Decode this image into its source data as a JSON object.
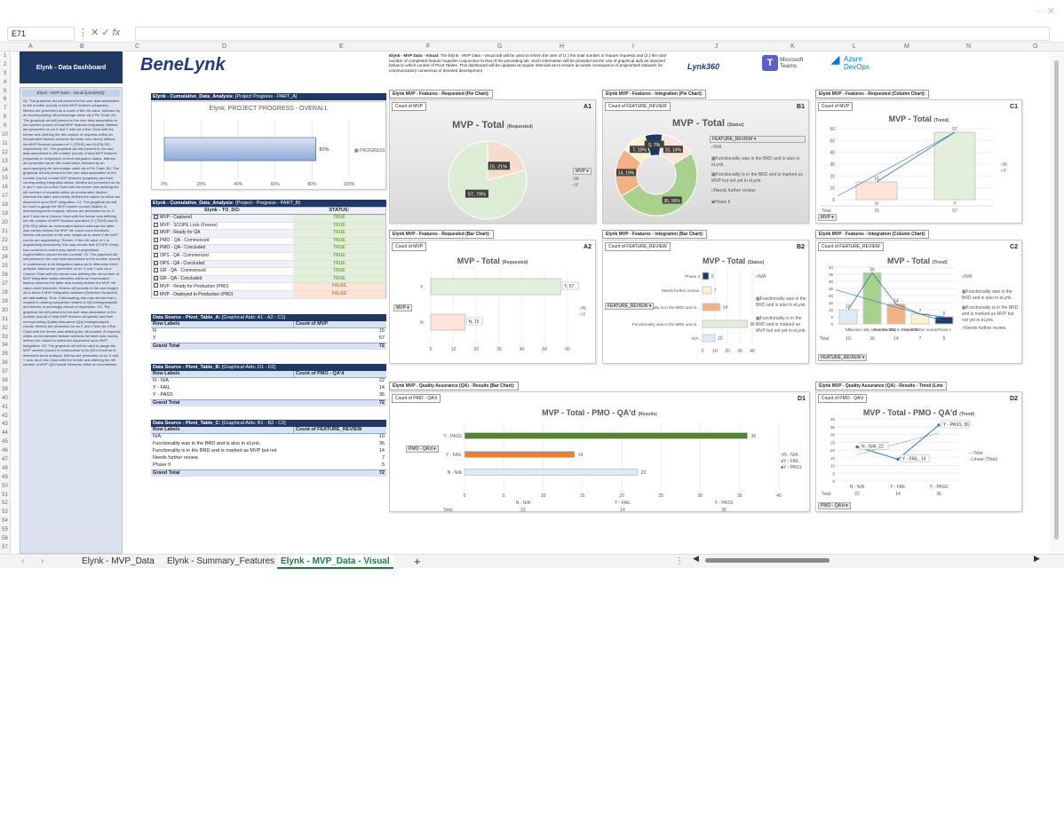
{
  "window": {
    "title_controls": "··· ✕"
  },
  "formula_bar": {
    "cell_ref": "E71",
    "fx": "fx",
    "value": ""
  },
  "columns": [
    "A",
    "B",
    "C",
    "D",
    "E",
    "F",
    "G",
    "H",
    "I",
    "J",
    "K",
    "L",
    "M",
    "N",
    "O"
  ],
  "header": {
    "dashboard_title": "Elynk - Data Dashboard",
    "logo": "BeneLynk",
    "intro_bold": "Elynk - MVP Data - Visual:",
    "intro_text": "The Elynk - MVP Data - Visual tab will be used to inform the user of (1.) the total number or feature requests and (2.) the total number of completed feature requests conjunctive to that of the preceding tab. Such information will be provided via the use of graphical aids as depicted below to which consist of Pivot Tables. This dashboard will be updated at regular intervals as to ensure accurate conveyance of project/task statuses for communicatory consensus of denoted development",
    "lynk360": "Lynk360",
    "teams": "Microsoft Teams",
    "azure": "Azure DevOps"
  },
  "legend_panel": {
    "title": "Elynk - MVP Data - Visual [LEGEND]:",
    "text": "A1: The graphical aid will present to the user data associative to the number (count) of total MVP features (requests). Metrics are presented as a count of the nth value, followed by an accompanying nth percentage value via a Pie Chart. A2: The graphical aid will present to the user data associative to the number (count) of total MVP features (requests). Metrics are presented on an X and Y axis via a Bar Chart with the former axis defining the nth number of requests within an enumerated fashion whereas the latter axis merely defines the MVP Boolean operator of Y (TRUE) and N (FALSE) respectively. B1: The graphical aid will present to the user data associated to the number (count) of total MVP features (requests) in conjunction to their integration status. Metrics are presented as an nth count value, followed by an accompanying nth percentage value via a Pie Chart. B2: The graphical aid will present to the user data associative to the number (count) of total MVP features (requests) and their corresponding integration status. Metrics are presented on an X and Y axis via a Bar Chart with the former axis defining the nth number of requests within an enumerated fashion whereas the latter axis merely defines the values to which are dependent upon MVP integration. C1: The graphical aid will be used to gauge the MVP number (count) relative to determining trend analysis. Metrics are presented on an X and Y axis via a Column Chart with the former axis defining the nth number of MVP Boolean operators (Y (TRUE) and N (FALSE)) within an enumerated fashion whereas the latter axis merely defines the MVP nth value count threshold. Metrics will provide to the user insight as to deem if the MVP counts are augmenting. Therein, if the nth value of Y is augmenting excessively, this may denote that SCOPE Creep has occurred to which may stymie a project/task. Augmentation should remain nominal. C2: The graphical aid will present to the user data associative to the number (count) in coalescence to its integration status as to determine trend analysis. Metrics are presented on an X and Y axis via a Column Chart with the former axis defining the nth number of MVP integration status elements within an enumerated fashion whereas the latter axis merely defines the MVP nth value count threshold. Metrics will provide to the user insight as to deem if MVP integration statuses (Selection Required) are attenuating. Thus, if attenuating, this may denote that a request is nearing completion relative to QA testing/analysis and therein, is seemingly devoid of regression. D1: The graphical aid will present to the user data associative to the number (count) of total MVP features (requests) and their corresponding Quality Assurance (QA) testing/analysis results. Metrics are presented on an X and Y axis via a Bar Chart with the former axis defining the nth number of requests within an enumerated fashion whereas the latter axis merely defines the values to which are dependent upon MVP integration. D2: The graphical aid will be used to gauge the MVP number (count) in coalescence to its QA'd result as to determine trend analysis. Metrics are presented on an X and Y axis via a Line Chart with the former axis defining the nth number of MVP QA'd result elements within an enumerated"
  },
  "progress": {
    "section": "Elynk - Cumulative_Data_Analysis",
    "subtitle": "[Project Progress - PART_A]",
    "chart_title": "Elynk: PROJECT PROGRESS - OVERALL",
    "value_label": "82%",
    "legend": "PROGRESS",
    "ticks": [
      "0%",
      "20%",
      "40%",
      "60%",
      "80%",
      "100%"
    ]
  },
  "todo": {
    "section": "Elynk - Cumulative_Data_Analysis",
    "subtitle": "(Project - Progress - PART_B)",
    "col1": "Elynk - TO_DO:",
    "col2": "STATUS:",
    "rows": [
      {
        "label": "MVP - Captured",
        "status": "TRUE"
      },
      {
        "label": "MVP - SCOPE Lock (Freeze)",
        "status": "TRUE"
      },
      {
        "label": "MVP - Ready for QA",
        "status": "TRUE"
      },
      {
        "label": "PMO - QA - Commenced",
        "status": "TRUE"
      },
      {
        "label": "PMO - QA - Concluded",
        "status": "TRUE"
      },
      {
        "label": "OPS - QA - Commenced",
        "status": "TRUE"
      },
      {
        "label": "OPS - QA - Concluded",
        "status": "TRUE"
      },
      {
        "label": "GR - QA - Commenced",
        "status": "TRUE"
      },
      {
        "label": "GR - QA - Concluded",
        "status": "TRUE"
      },
      {
        "label": "MVP - Ready for Production (PRD)",
        "status": "FALSE"
      },
      {
        "label": "MVP - Deployed to Production (PRD)",
        "status": "FALSE"
      }
    ]
  },
  "pivot_a": {
    "title": "Data Source - Pivot_Table_A:",
    "sub": "[Graphical Aids: A1 - A2 - C1]",
    "h1": "Row Labels",
    "h2": "Count of MVP",
    "rows": [
      {
        "l": "N",
        "v": "15"
      },
      {
        "l": "Y",
        "v": "57"
      }
    ],
    "total_label": "Grand Total",
    "total": "72"
  },
  "pivot_b": {
    "title": "Data Source - Pivot_Table_B:",
    "sub": "[Graphical Aids: D1 - D2]",
    "h1": "Row Labels",
    "h2": "Count of PMO - QA'd",
    "rows": [
      {
        "l": "N - N/A",
        "v": "22"
      },
      {
        "l": "Y - FAIL",
        "v": "14"
      },
      {
        "l": "Y - PASS",
        "v": "36"
      }
    ],
    "total_label": "Grand Total",
    "total": "72"
  },
  "pivot_c": {
    "title": "Data Source - Pivot_Table_C:",
    "sub": "[Graphical Aids: B1 - B2 - C2]",
    "h1": "Row Labels",
    "h2": "Count of FEATURE_REVIEW",
    "rows": [
      {
        "l": "N/A.",
        "v": "10"
      },
      {
        "l": "Functionality was in the BRD and is also in eLynk.",
        "v": "36"
      },
      {
        "l": "Functionality is in the BRD and is marked as MVP but not",
        "v": "14"
      },
      {
        "l": "Needs further review.",
        "v": "7"
      },
      {
        "l": "Phase II",
        "v": "5"
      }
    ],
    "total_label": "Grand Total",
    "total": "72"
  },
  "a1": {
    "label": "Elynk MVP - Features - Requested (Pie Chart):",
    "code": "A1",
    "field": "Count of MVP",
    "title": "MVP - Total",
    "title_sub": "(Requested)",
    "filter": "MVP",
    "legend": [
      "N",
      "Y"
    ],
    "colors": [
      "#f7dccd",
      "#dcecd5"
    ]
  },
  "b1": {
    "label": "Elynk MVP - Features - Integration (Pie Chart):",
    "code": "B1",
    "field": "Count of FEATURE_REVIEW",
    "title": "MVP - Total",
    "title_sub": "(Status)",
    "filter": "FEATURE_REVIEW",
    "legend": [
      "N/A",
      "Functionality was in the BRD and is also in eLynk.",
      "Functionality is in the BRD and is marked as MVP but not yet in eLynk.",
      "Needs further review.",
      "Phase II"
    ]
  },
  "c1": {
    "label": "Elynk MVP - Features - Requested (Column Chart):",
    "code": "C1",
    "field": "Count of MVP",
    "title": "MVP - Total",
    "title_sub": "(Trend)",
    "filter": "MVP",
    "legend": [
      "N",
      "Y"
    ],
    "row_total": "Total"
  },
  "a2": {
    "label": "Elynk MVP - Features - Requested (Bar Chart):",
    "code": "A2",
    "field": "Count of MVP",
    "title": "MVP - Total",
    "title_sub": "(Requested)",
    "filter": "MVP",
    "legend": [
      "N",
      "Y"
    ]
  },
  "b2": {
    "label": "Elynk MVP - Features - Integration (Bar Chart):",
    "code": "B2",
    "field": "Count of FEATURE_REVIEW",
    "title": "MVP - Total",
    "title_sub": "(Status)",
    "filter": "FEATURE_REVIEW",
    "legend": [
      "N/A",
      "Functionality was in the BRD and is also in eLynk.",
      "Functionality is in the BRD and is marked as MVP but not yet in eLynk."
    ]
  },
  "c2": {
    "label": "Elynk MVP - Features - Integration (Column Chart):",
    "code": "C2",
    "field": "Count of FEATURE_REVIEW",
    "title": "MVP - Total",
    "title_sub": "(Trend)",
    "filter": "FEATURE_REVIEW",
    "legend": [
      "N/A",
      "Functionality was in the BRD and is also in eLynk.",
      "Functionality is in the BRD and is marked as MVP but not yet in eLynk.",
      "Needs further review."
    ],
    "row_total": "Total"
  },
  "d1": {
    "label": "Elynk MVP - Quality Assurance (QA) - Results (Bar Chart):",
    "code": "D1",
    "field": "Count of PMO - QA'd",
    "title": "MVP - Total - PMO - QA'd",
    "title_sub": "(Results)",
    "filter": "PMO - QA'd",
    "legend": [
      "N - N/A",
      "Y - FAIL",
      "Y - PASS"
    ],
    "row_total": "Total"
  },
  "d2": {
    "label": "Elynk MVP - Quality Assurance (QA) - Results - Trend (Line",
    "code": "D2",
    "field": "Count of PMO - QA'd",
    "title": "MVP - Total - PMO - QA'd",
    "title_sub": "(Trend)",
    "filter": "PMO - QA'd",
    "legend": [
      "Total",
      "Linear (Total)"
    ],
    "row_total": "Total"
  },
  "chart_data": [
    {
      "type": "bar",
      "id": "progress",
      "categories": [
        "PROGRESS"
      ],
      "values": [
        82
      ],
      "title": "Elynk: PROJECT PROGRESS - OVERALL",
      "xlim": [
        0,
        100
      ]
    },
    {
      "type": "pie",
      "id": "A1",
      "categories": [
        "N",
        "Y"
      ],
      "values": [
        15,
        57
      ],
      "labels": [
        "15, 21%",
        "57, 79%"
      ],
      "title": "MVP - Total (Requested)"
    },
    {
      "type": "pie",
      "id": "B1",
      "categories": [
        "N/A",
        "Functionality was in the BRD and is also in eLynk.",
        "Functionality is in the BRD and is marked as MVP but not yet in eLynk.",
        "Needs further review.",
        "Phase II"
      ],
      "values": [
        10,
        36,
        14,
        7,
        5
      ],
      "labels": [
        "10, 14%",
        "36, 50%",
        "14, 19%",
        "7, 10%",
        "5, 7%"
      ],
      "title": "MVP - Total (Status)"
    },
    {
      "type": "bar",
      "id": "C1",
      "categories": [
        "N",
        "Y"
      ],
      "values": [
        15,
        57
      ],
      "ylim": [
        0,
        60
      ],
      "title": "MVP - Total (Trend)"
    },
    {
      "type": "bar",
      "id": "A2",
      "categories": [
        "N",
        "Y"
      ],
      "values": [
        15,
        57
      ],
      "labels": [
        "N, 15",
        "Y, 57"
      ],
      "xlim": [
        0,
        60
      ],
      "title": "MVP - Total (Requested)"
    },
    {
      "type": "bar",
      "id": "B2",
      "categories": [
        "N/A.",
        "Functionality is in the BRD and is...",
        "Needs further review.",
        "Phase II"
      ],
      "values": [
        10,
        14,
        7,
        5
      ],
      "extra": {
        "Functionality was in the BRD and is...": 36
      },
      "xlim": [
        0,
        40
      ],
      "title": "MVP - Total (Status)"
    },
    {
      "type": "bar",
      "id": "C2",
      "categories": [
        "N/A",
        "Functionality was in the BRD and is also...",
        "Functionality is in the BRD and is marked...",
        "Needs further review.",
        "Phase II"
      ],
      "values": [
        10,
        36,
        14,
        7,
        5
      ],
      "ylim": [
        0,
        40
      ],
      "title": "MVP - Total (Trend)"
    },
    {
      "type": "bar",
      "id": "D1",
      "categories": [
        "N - N/A",
        "Y - FAIL",
        "Y - PASS"
      ],
      "values": [
        22,
        14,
        36
      ],
      "xlim": [
        0,
        40
      ],
      "title": "MVP - Total - PMO - QA'd (Results)"
    },
    {
      "type": "line",
      "id": "D2",
      "categories": [
        "N - N/A",
        "Y - FAIL",
        "Y - PASS"
      ],
      "values": [
        22,
        14,
        36
      ],
      "labels": [
        "N - N/A, 22",
        "Y - FAIL, 14",
        "Y - PASS, 36"
      ],
      "ylim": [
        0,
        40
      ],
      "title": "MVP - Total - PMO - QA'd (Trend)"
    }
  ],
  "tabs": [
    "Elynk - MVP_Data",
    "Elynk - Summary_Features",
    "Elynk - MVP_Data - Visual"
  ],
  "add_sheet": "+"
}
